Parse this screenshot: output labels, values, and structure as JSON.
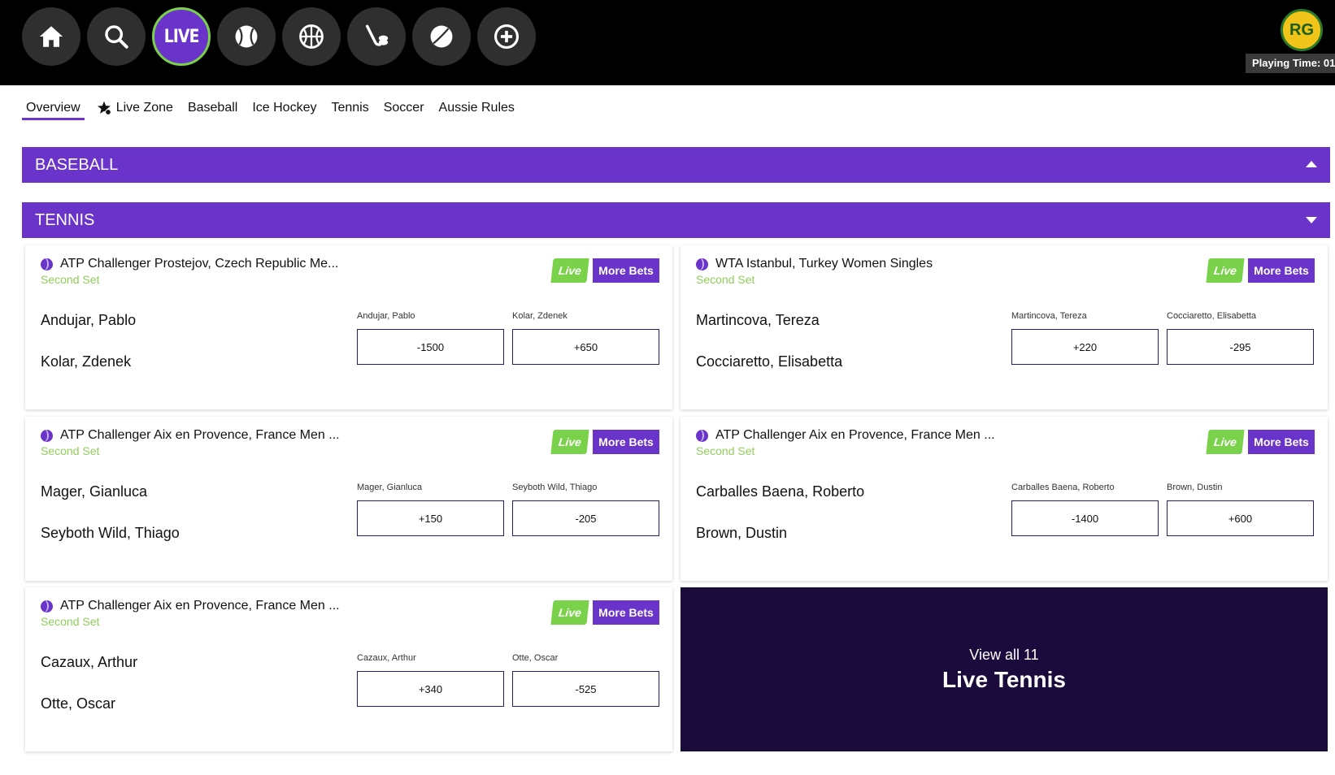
{
  "topbar": {
    "nav_icons": [
      "home-icon",
      "search-icon",
      "live",
      "baseball-icon",
      "basketball-icon",
      "hockey-icon",
      "tennis-icon",
      "more-icon"
    ],
    "live_label": "LIVE",
    "logo_text": "RG",
    "playing_time": "Playing Time: 01"
  },
  "subnav": {
    "items": [
      "Overview",
      "Live Zone",
      "Baseball",
      "Ice Hockey",
      "Tennis",
      "Soccer",
      "Aussie Rules"
    ]
  },
  "sections": {
    "baseball": "BASEBALL",
    "tennis": "TENNIS"
  },
  "matches": [
    {
      "tournament": "ATP Challenger Prostejov, Czech Republic Me...",
      "status": "Second Set",
      "live": "Live",
      "more_bets": "More Bets",
      "player1": "Andujar, Pablo",
      "player2": "Kolar, Zdenek",
      "odd1_label": "Andujar, Pablo",
      "odd1": "-1500",
      "odd2_label": "Kolar, Zdenek",
      "odd2": "+650"
    },
    {
      "tournament": "WTA Istanbul, Turkey Women Singles",
      "status": "Second Set",
      "live": "Live",
      "more_bets": "More Bets",
      "player1": "Martincova, Tereza",
      "player2": "Cocciaretto, Elisabetta",
      "odd1_label": "Martincova, Tereza",
      "odd1": "+220",
      "odd2_label": "Cocciaretto, Elisabetta",
      "odd2": "-295"
    },
    {
      "tournament": "ATP Challenger Aix en Provence, France Men ...",
      "status": "Second Set",
      "live": "Live",
      "more_bets": "More Bets",
      "player1": "Mager, Gianluca",
      "player2": "Seyboth Wild, Thiago",
      "odd1_label": "Mager, Gianluca",
      "odd1": "+150",
      "odd2_label": "Seyboth Wild, Thiago",
      "odd2": "-205"
    },
    {
      "tournament": "ATP Challenger Aix en Provence, France Men ...",
      "status": "Second Set",
      "live": "Live",
      "more_bets": "More Bets",
      "player1": "Carballes Baena, Roberto",
      "player2": "Brown, Dustin",
      "odd1_label": "Carballes Baena, Roberto",
      "odd1": "-1400",
      "odd2_label": "Brown, Dustin",
      "odd2": "+600"
    },
    {
      "tournament": "ATP Challenger Aix en Provence, France Men ...",
      "status": "Second Set",
      "live": "Live",
      "more_bets": "More Bets",
      "player1": "Cazaux, Arthur",
      "player2": "Otte, Oscar",
      "odd1_label": "Cazaux, Arthur",
      "odd1": "+340",
      "odd2_label": "Otte, Oscar",
      "odd2": "-525"
    }
  ],
  "view_all": {
    "line1": "View all 11",
    "line2": "Live Tennis"
  },
  "colors": {
    "accent": "#6a33c9",
    "live_green": "#7ad14a",
    "dark_panel": "#1b0b3d",
    "topbar": "#000000"
  }
}
